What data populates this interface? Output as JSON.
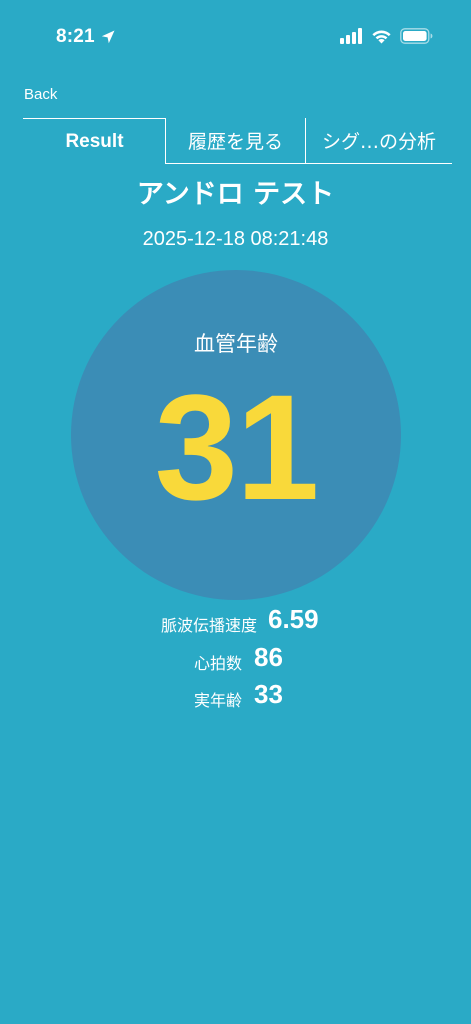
{
  "status_bar": {
    "time": "8:21",
    "icons": [
      "location-arrow-icon",
      "cellular-signal-icon",
      "wifi-icon",
      "battery-icon"
    ]
  },
  "nav": {
    "back_label": "Back"
  },
  "tabs": [
    {
      "label": "Result",
      "selected": true
    },
    {
      "label": "履歴を見る",
      "selected": false
    },
    {
      "label": "シグ…の分析",
      "selected": false
    }
  ],
  "header": {
    "title": "アンドロ テスト",
    "timestamp": "2025-12-18 08:21:48"
  },
  "vascular_age": {
    "label": "血管年齢",
    "value": "31"
  },
  "metrics": [
    {
      "label": "脈波伝播速度",
      "value": "6.59"
    },
    {
      "label": "心拍数",
      "value": "86"
    },
    {
      "label": "実年齢",
      "value": "33"
    }
  ],
  "colors": {
    "background": "#2aaac6",
    "circle": "#3b8db6",
    "accent_value": "#f9d93a",
    "text": "#ffffff"
  }
}
